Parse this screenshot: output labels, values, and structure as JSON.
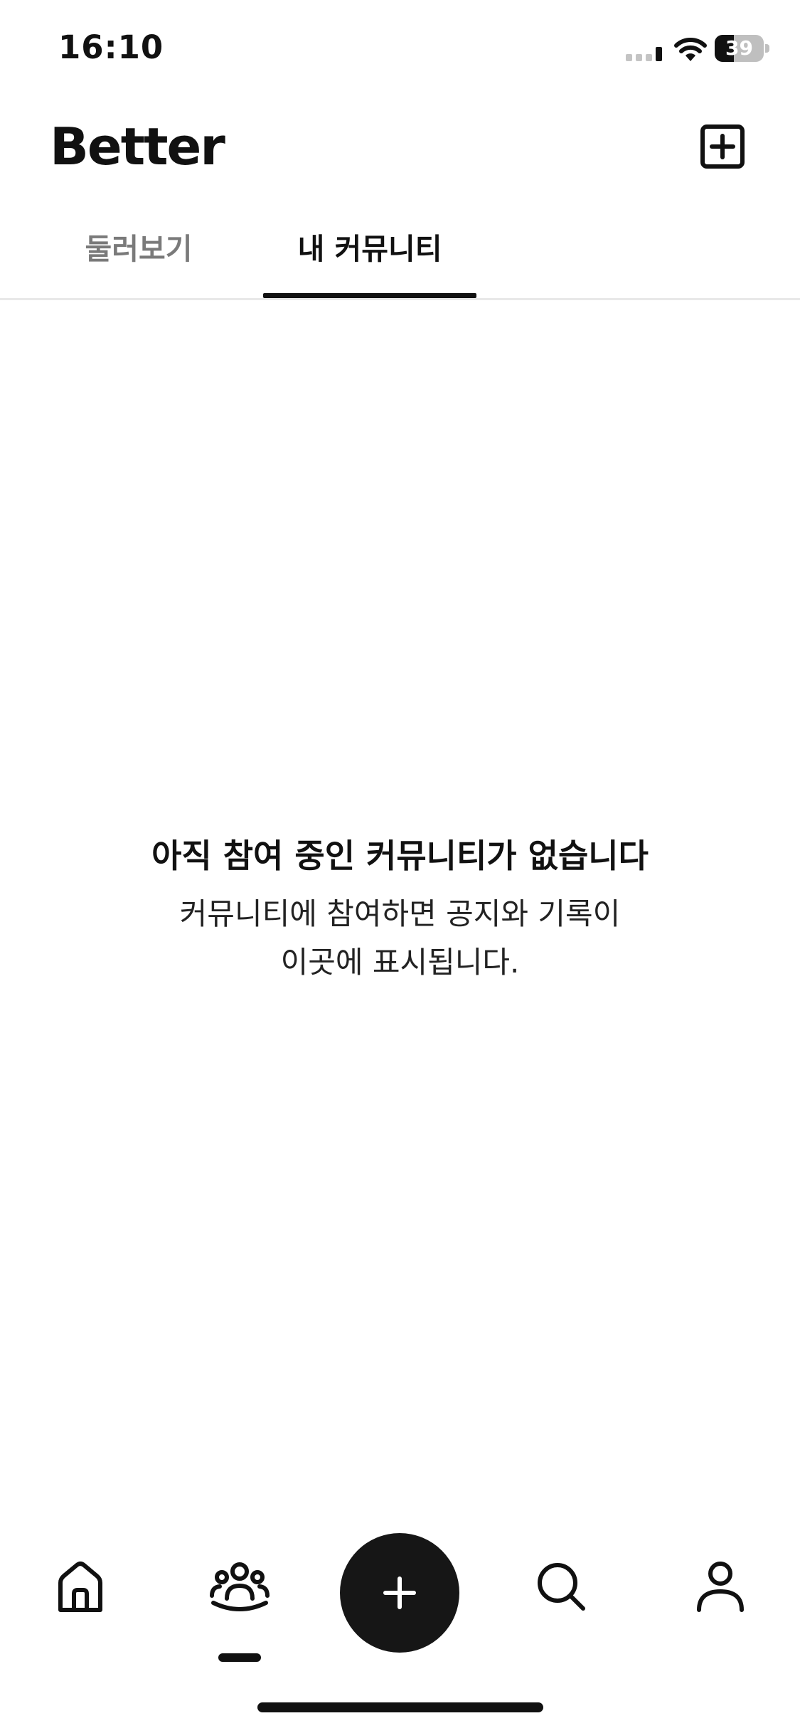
{
  "status_bar": {
    "time": "16:10",
    "battery_percent": "39",
    "battery_level": 0.39,
    "icons": [
      "cellular-signal-icon",
      "wifi-icon",
      "battery-icon"
    ]
  },
  "header": {
    "logo_text": "Better",
    "add_icon": "plus-square-icon"
  },
  "tabs": [
    {
      "label": "둘러보기",
      "selected": false
    },
    {
      "label": "내 커뮤니티",
      "selected": true
    }
  ],
  "empty_state": {
    "title": "아직 참여 중인 커뮤니티가 없습니다",
    "description_line1": "커뮤니티에 참여하면 공지와 기록이",
    "description_line2": "이곳에 표시됩니다."
  },
  "bottom_nav": {
    "items": [
      {
        "icon": "home-icon",
        "active": false
      },
      {
        "icon": "community-icon",
        "active": true
      },
      {
        "icon": "plus-icon",
        "active": false
      },
      {
        "icon": "search-icon",
        "active": false
      },
      {
        "icon": "profile-icon",
        "active": false
      }
    ]
  },
  "colors": {
    "primary": "#111111",
    "tab_inactive": "#7a7a7a",
    "divider": "#e8e8e8",
    "background": "#ffffff"
  }
}
